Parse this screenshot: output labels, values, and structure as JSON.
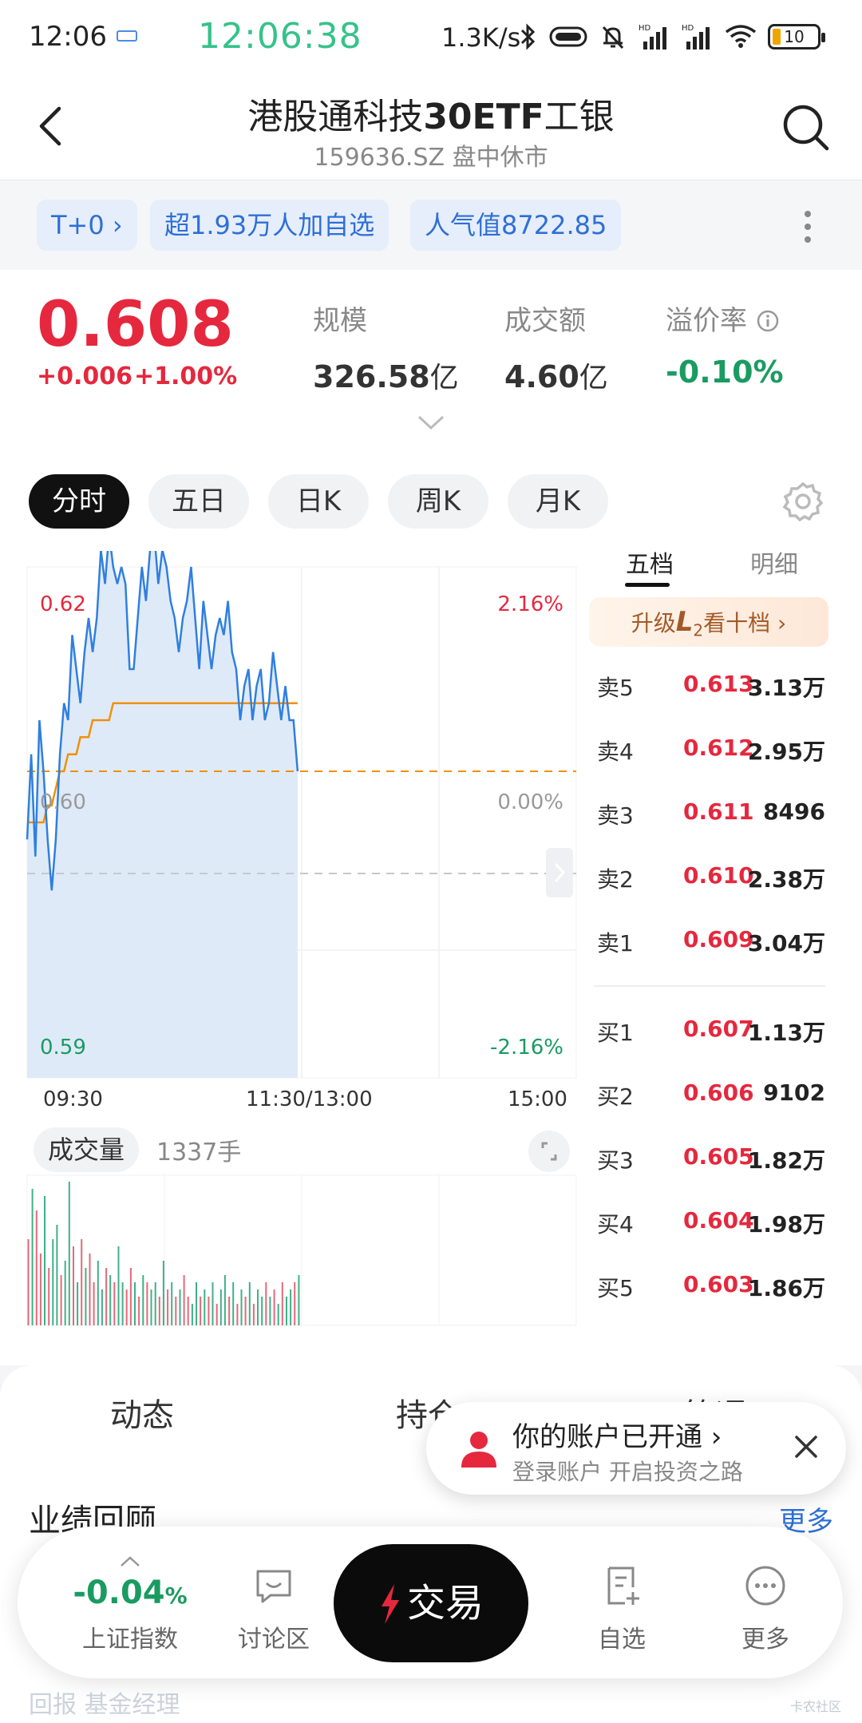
{
  "status_bar": {
    "time": "12:06",
    "clock": "12:06:38",
    "net_speed": "1.3K/s",
    "battery": "10"
  },
  "header": {
    "title_pre": "港股通科技",
    "title_bold": "30ETF",
    "title_post": "工银",
    "subtitle": "159636.SZ 盘中休市"
  },
  "tags": {
    "t0": "T+0 ›",
    "watchers": "超1.93万人加自选",
    "popularity": "人气值8722.85"
  },
  "quote": {
    "price": "0.608",
    "change": "+0.006",
    "change_pct": "+1.00%",
    "scale_label": "规模",
    "scale_value": "326.58",
    "scale_unit": "亿",
    "turnover_label": "成交额",
    "turnover_value": "4.60",
    "turnover_unit": "亿",
    "premium_label": "溢价率",
    "premium_value": "-0.10%"
  },
  "period_tabs": [
    "分时",
    "五日",
    "日K",
    "周K",
    "月K"
  ],
  "chart": {
    "price_high": "0.62",
    "price_mid": "0.60",
    "price_low": "0.59",
    "pct_high": "2.16%",
    "pct_mid": "0.00%",
    "pct_low": "-2.16%",
    "time_start": "09:30",
    "time_mid": "11:30/13:00",
    "time_end": "15:00",
    "volume_label": "成交量",
    "volume_value": "1337手"
  },
  "chart_data": {
    "type": "line",
    "title": "",
    "ylim": [
      0.59,
      0.62
    ],
    "prev_close": 0.602,
    "x_range": [
      "09:30",
      "15:00"
    ],
    "series": [
      {
        "values": [
          0.604,
          0.609,
          0.603,
          0.611,
          0.608,
          0.604,
          0.601,
          0.604,
          0.609,
          0.612,
          0.611,
          0.616,
          0.614,
          0.612,
          0.615,
          0.617,
          0.615,
          0.617,
          0.621,
          0.619,
          0.622,
          0.62,
          0.619,
          0.62,
          0.619,
          0.614,
          0.614,
          0.617,
          0.62,
          0.618,
          0.621,
          0.622,
          0.619,
          0.621,
          0.62,
          0.618,
          0.617,
          0.615,
          0.617,
          0.618,
          0.62,
          0.617,
          0.614,
          0.618,
          0.616,
          0.614,
          0.616,
          0.617,
          0.616,
          0.618,
          0.615,
          0.614,
          0.611,
          0.613,
          0.614,
          0.611,
          0.613,
          0.614,
          0.611,
          0.612,
          0.615,
          0.613,
          0.611,
          0.613,
          0.611,
          0.611,
          0.608
        ]
      },
      {
        "values": [
          0.605,
          0.605,
          0.605,
          0.605,
          0.605,
          0.606,
          0.606,
          0.607,
          0.608,
          0.608,
          0.609,
          0.609,
          0.609,
          0.61,
          0.61,
          0.61,
          0.611,
          0.611,
          0.611,
          0.611,
          0.611,
          0.612,
          0.612,
          0.612,
          0.612,
          0.612,
          0.612,
          0.612,
          0.612,
          0.612,
          0.612,
          0.612,
          0.612,
          0.612,
          0.612,
          0.612,
          0.612,
          0.612,
          0.612,
          0.612,
          0.612,
          0.612,
          0.612,
          0.612,
          0.612,
          0.612,
          0.612,
          0.612,
          0.612,
          0.612,
          0.612,
          0.612,
          0.612,
          0.612,
          0.612,
          0.612,
          0.612,
          0.612,
          0.612,
          0.612,
          0.612,
          0.612,
          0.612,
          0.612,
          0.612,
          0.612,
          0.612
        ]
      }
    ],
    "volume": [
      0.6,
      0.95,
      0.8,
      0.5,
      0.9,
      0.4,
      0.6,
      0.7,
      0.35,
      0.45,
      1.0,
      0.55,
      0.3,
      0.6,
      0.4,
      0.5,
      0.3,
      0.45,
      0.25,
      0.4,
      0.35,
      0.3,
      0.55,
      0.3,
      0.25,
      0.4,
      0.3,
      0.2,
      0.35,
      0.3,
      0.25,
      0.3,
      0.2,
      0.45,
      0.25,
      0.3,
      0.2,
      0.25,
      0.35,
      0.2,
      0.15,
      0.3,
      0.2,
      0.25,
      0.2,
      0.3,
      0.15,
      0.25,
      0.35,
      0.2,
      0.3,
      0.15,
      0.25,
      0.2,
      0.3,
      0.15,
      0.25,
      0.2,
      0.3,
      0.2,
      0.25,
      0.15,
      0.3,
      0.2,
      0.25,
      0.3,
      0.35
    ],
    "volume_colors": [
      "r",
      "g",
      "r",
      "r",
      "g",
      "r",
      "g",
      "g",
      "r",
      "g",
      "g",
      "r",
      "g",
      "r",
      "g",
      "r",
      "r",
      "g",
      "g",
      "r",
      "g",
      "r",
      "g",
      "g",
      "r",
      "r",
      "g",
      "r",
      "g",
      "r",
      "g",
      "g",
      "r",
      "g",
      "r",
      "g",
      "r",
      "g",
      "r",
      "r",
      "g",
      "g",
      "r",
      "g",
      "r",
      "g",
      "r",
      "g",
      "g",
      "r",
      "g",
      "r",
      "g",
      "r",
      "g",
      "r",
      "g",
      "g",
      "r",
      "g",
      "r",
      "g",
      "r",
      "g",
      "g",
      "r",
      "g"
    ]
  },
  "order_book": {
    "tab_five": "五档",
    "tab_detail": "明细",
    "upgrade_pre": "升级",
    "upgrade_l2": "L",
    "upgrade_sub": "2",
    "upgrade_post": "看十档 ›",
    "asks": [
      {
        "label": "卖5",
        "price": "0.613",
        "qty": "3.13万"
      },
      {
        "label": "卖4",
        "price": "0.612",
        "qty": "2.95万"
      },
      {
        "label": "卖3",
        "price": "0.611",
        "qty": "8496"
      },
      {
        "label": "卖2",
        "price": "0.610",
        "qty": "2.38万"
      },
      {
        "label": "卖1",
        "price": "0.609",
        "qty": "3.04万"
      }
    ],
    "bids": [
      {
        "label": "买1",
        "price": "0.607",
        "qty": "1.13万"
      },
      {
        "label": "买2",
        "price": "0.606",
        "qty": "9102"
      },
      {
        "label": "买3",
        "price": "0.605",
        "qty": "1.82万"
      },
      {
        "label": "买4",
        "price": "0.604",
        "qty": "1.98万"
      },
      {
        "label": "买5",
        "price": "0.603",
        "qty": "1.86万"
      }
    ]
  },
  "section_tabs": [
    "动态",
    "持仓",
    "简况"
  ],
  "performance": {
    "title": "业绩回顾",
    "more": "更多"
  },
  "toast": {
    "title": "你的账户已开通 ›",
    "subtitle": "登录账户 开启投资之路"
  },
  "bottom_nav": {
    "index_value": "-0.04",
    "index_pct": "%",
    "index_label": "上证指数",
    "discuss_label": "讨论区",
    "trade_label": "交易",
    "watch_label": "自选",
    "more_label": "更多"
  },
  "ghost_text": "回报 基金经理",
  "watermark": "卡农社区",
  "colors": {
    "up": "#e5283e",
    "down": "#1a9b62",
    "accent": "#2e6fd6",
    "price_line": "#2f7fe0",
    "avg_line": "#f0900a"
  }
}
